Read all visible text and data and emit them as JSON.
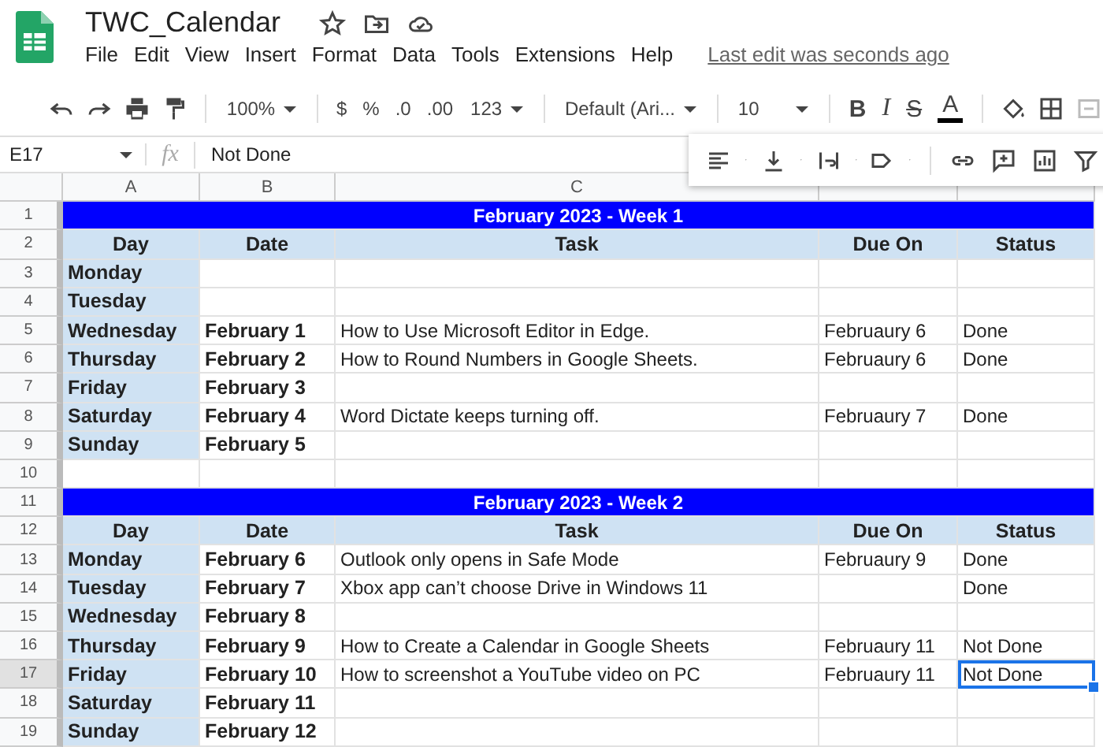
{
  "app": {
    "title": "TWC_Calendar",
    "menu": [
      "File",
      "Edit",
      "View",
      "Insert",
      "Format",
      "Data",
      "Tools",
      "Extensions",
      "Help"
    ],
    "last_edit": "Last edit was seconds ago"
  },
  "toolbar": {
    "zoom": "100%",
    "currency": "$",
    "percent": "%",
    "decrease_decimals": ".0",
    "increase_decimals": ".00",
    "number_format": "123",
    "font": "Default (Ari...",
    "font_size": "10",
    "bold": "B",
    "italic": "I",
    "strikethrough": "S",
    "text_color": "A"
  },
  "formula_bar": {
    "cell": "E17",
    "fx": "fx",
    "value": "Not Done"
  },
  "columns": [
    "A",
    "B",
    "C"
  ],
  "rows": [
    {
      "number": "1",
      "kind": "title",
      "text": "February 2023 - Week 1",
      "selected": false
    },
    {
      "number": "2",
      "kind": "header",
      "cells": [
        "Day",
        "Date",
        "Task",
        "Due On",
        "Status"
      ],
      "selected": false
    },
    {
      "number": "3",
      "kind": "data",
      "day": "Monday",
      "selected": false
    },
    {
      "number": "4",
      "kind": "data",
      "day": "Tuesday",
      "selected": false
    },
    {
      "number": "5",
      "kind": "data",
      "day": "Wednesday",
      "date": "February 1",
      "task": "How to Use Microsoft Editor in Edge.",
      "due_on": "Februaury 6",
      "status": "Done",
      "selected": false
    },
    {
      "number": "6",
      "kind": "data",
      "day": "Thursday",
      "date": "February 2",
      "task": "How to Round Numbers in Google Sheets.",
      "due_on": "Februaury 6",
      "status": "Done",
      "selected": false
    },
    {
      "number": "7",
      "kind": "data",
      "day": "Friday",
      "date": "February 3",
      "selected": false
    },
    {
      "number": "8",
      "kind": "data",
      "day": "Saturday",
      "date": "February 4",
      "task": "Word Dictate keeps turning off.",
      "due_on": "Februaury 7",
      "status": "Done",
      "selected": false
    },
    {
      "number": "9",
      "kind": "data",
      "day": "Sunday",
      "date": "February 5",
      "selected": false
    },
    {
      "number": "10",
      "kind": "blank",
      "selected": false
    },
    {
      "number": "11",
      "kind": "title",
      "text": "February 2023 - Week 2",
      "selected": false
    },
    {
      "number": "12",
      "kind": "header",
      "cells": [
        "Day",
        "Date",
        "Task",
        "Due On",
        "Status"
      ],
      "selected": false
    },
    {
      "number": "13",
      "kind": "data",
      "day": "Monday",
      "date": "February 6",
      "task": "Outlook only opens in Safe Mode",
      "due_on": "Februaury 9",
      "status": "Done",
      "selected": false
    },
    {
      "number": "14",
      "kind": "data",
      "day": "Tuesday",
      "date": "February 7",
      "task": "Xbox app can’t choose Drive in Windows 11",
      "status": "Done",
      "selected": false
    },
    {
      "number": "15",
      "kind": "data",
      "day": "Wednesday",
      "date": "February 8",
      "selected": false
    },
    {
      "number": "16",
      "kind": "data",
      "day": "Thursday",
      "date": "February 9",
      "task": "How to Create a Calendar in Google Sheets",
      "due_on": "Februaury 11",
      "status": "Not Done",
      "selected": false
    },
    {
      "number": "17",
      "kind": "data",
      "day": "Friday",
      "date": "February 10",
      "task": "How to screenshot a YouTube video on PC",
      "due_on": "Februaury 11",
      "status": "Not Done",
      "selected": true
    },
    {
      "number": "18",
      "kind": "data",
      "day": "Saturday",
      "date": "February 11",
      "selected": false
    },
    {
      "number": "19",
      "kind": "data",
      "day": "Sunday",
      "date": "February 12",
      "selected": false
    }
  ]
}
